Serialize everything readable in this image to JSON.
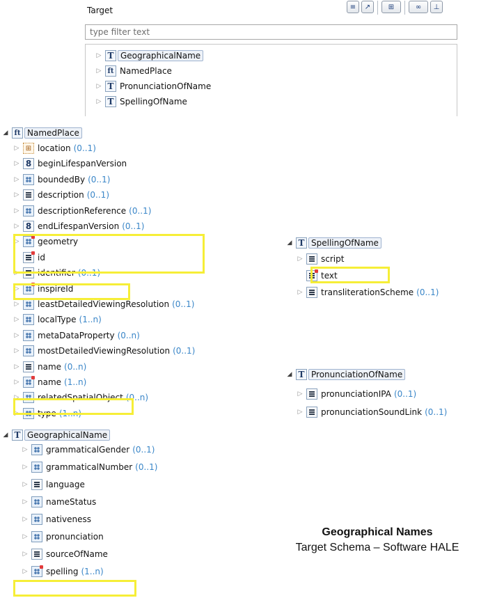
{
  "panel": {
    "title": "Target",
    "filter_placeholder": "type filter text",
    "toolbar": [
      "list-view-icon",
      "collapse-icon",
      "schema-tree-icon",
      "types-icon",
      "hierarchy-icon"
    ],
    "types": [
      {
        "icon": "T",
        "label": "GeographicalName"
      },
      {
        "icon": "ft",
        "label": "NamedPlace"
      },
      {
        "icon": "T",
        "label": "PronunciationOfName"
      },
      {
        "icon": "T",
        "label": "SpellingOfName"
      }
    ]
  },
  "named_place": {
    "label": "NamedPlace",
    "properties": [
      {
        "icon": "geo",
        "name": "location",
        "card": "(0..1)"
      },
      {
        "icon": "8",
        "name": "beginLifespanVersion",
        "card": ""
      },
      {
        "icon": "cmp",
        "name": "boundedBy",
        "card": "(0..1)"
      },
      {
        "icon": "lines",
        "name": "description",
        "card": "(0..1)"
      },
      {
        "icon": "cmp",
        "name": "descriptionReference",
        "card": "(0..1)"
      },
      {
        "icon": "8",
        "name": "endLifespanVersion",
        "card": "(0..1)"
      },
      {
        "icon": "cmp-mand",
        "name": "geometry",
        "card": ""
      },
      {
        "icon": "lines-mand",
        "name": "id",
        "card": ""
      },
      {
        "icon": "lines",
        "name": "identifier",
        "card": "(0..1)"
      },
      {
        "icon": "cmp-mand",
        "name": "inspireId",
        "card": ""
      },
      {
        "icon": "cmp",
        "name": "leastDetailedViewingResolution",
        "card": "(0..1)"
      },
      {
        "icon": "cmp",
        "name": "localType",
        "card": "(1..n)"
      },
      {
        "icon": "cmp",
        "name": "metaDataProperty",
        "card": "(0..n)"
      },
      {
        "icon": "cmp",
        "name": "mostDetailedViewingResolution",
        "card": "(0..1)"
      },
      {
        "icon": "lines",
        "name": "name",
        "card": "(0..n)"
      },
      {
        "icon": "cmp-mand",
        "name": "name",
        "card": "(1..n)"
      },
      {
        "icon": "cmp",
        "name": "relatedSpatialObject",
        "card": "(0..n)"
      },
      {
        "icon": "cmp",
        "name": "type",
        "card": "(1..n)"
      }
    ]
  },
  "geographical_name": {
    "label": "GeographicalName",
    "properties": [
      {
        "icon": "cmp",
        "name": "grammaticalGender",
        "card": "(0..1)"
      },
      {
        "icon": "cmp",
        "name": "grammaticalNumber",
        "card": "(0..1)"
      },
      {
        "icon": "lines",
        "name": "language",
        "card": ""
      },
      {
        "icon": "cmp",
        "name": "nameStatus",
        "card": ""
      },
      {
        "icon": "cmp",
        "name": "nativeness",
        "card": ""
      },
      {
        "icon": "cmp",
        "name": "pronunciation",
        "card": ""
      },
      {
        "icon": "lines",
        "name": "sourceOfName",
        "card": ""
      },
      {
        "icon": "cmp-mand",
        "name": "spelling",
        "card": "(1..n)"
      }
    ]
  },
  "spelling_of_name": {
    "label": "SpellingOfName",
    "properties": [
      {
        "icon": "lines",
        "name": "script",
        "card": ""
      },
      {
        "icon": "lines-mand",
        "name": "text",
        "card": ""
      },
      {
        "icon": "lines",
        "name": "transliterationScheme",
        "card": "(0..1)"
      }
    ]
  },
  "pronunciation_of_name": {
    "label": "PronunciationOfName",
    "properties": [
      {
        "icon": "lines",
        "name": "pronunciationIPA",
        "card": "(0..1)"
      },
      {
        "icon": "lines",
        "name": "pronunciationSoundLink",
        "card": "(0..1)"
      }
    ]
  },
  "caption": {
    "line1": "Geographical Names",
    "line2": "Target Schema – Software HALE"
  },
  "colors": {
    "highlight": "#f6ee37",
    "cardinality": "#3a86c8"
  }
}
